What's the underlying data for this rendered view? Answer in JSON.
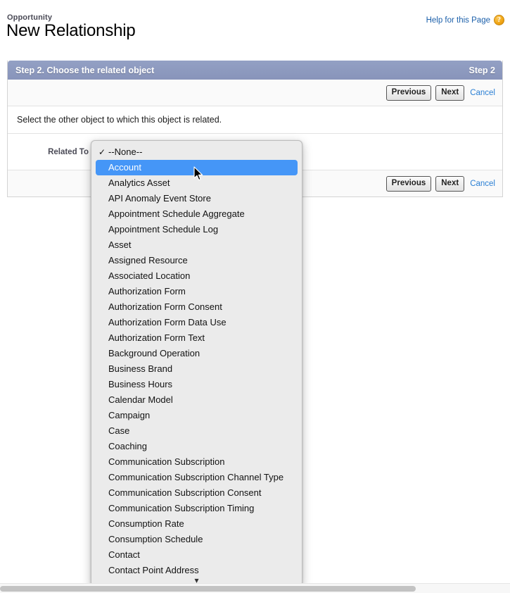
{
  "header": {
    "breadcrumb_object": "Opportunity",
    "page_title": "New Relationship",
    "help_link": "Help for this Page",
    "help_icon": "help-question-icon"
  },
  "panel": {
    "title": "Step 2. Choose the related object",
    "step_indicator": "Step 2",
    "description": "Select the other object to which this object is related.",
    "accent_color": "#8894ba"
  },
  "buttons": {
    "previous": "Previous",
    "next": "Next",
    "cancel": "Cancel"
  },
  "form": {
    "related_to_label": "Related To",
    "related_to_value": "--None--"
  },
  "dropdown": {
    "selected_value": "Account",
    "checked_value": "--None--",
    "highlight_color": "#4596f7",
    "scroll_down_icon": "chevron-down-icon",
    "options": [
      "--None--",
      "Account",
      "Analytics Asset",
      "API Anomaly Event Store",
      "Appointment Schedule Aggregate",
      "Appointment Schedule Log",
      "Asset",
      "Assigned Resource",
      "Associated Location",
      "Authorization Form",
      "Authorization Form Consent",
      "Authorization Form Data Use",
      "Authorization Form Text",
      "Background Operation",
      "Business Brand",
      "Business Hours",
      "Calendar Model",
      "Campaign",
      "Case",
      "Coaching",
      "Communication Subscription",
      "Communication Subscription Channel Type",
      "Communication Subscription Consent",
      "Communication Subscription Timing",
      "Consumption Rate",
      "Consumption Schedule",
      "Contact",
      "Contact Point Address"
    ]
  }
}
